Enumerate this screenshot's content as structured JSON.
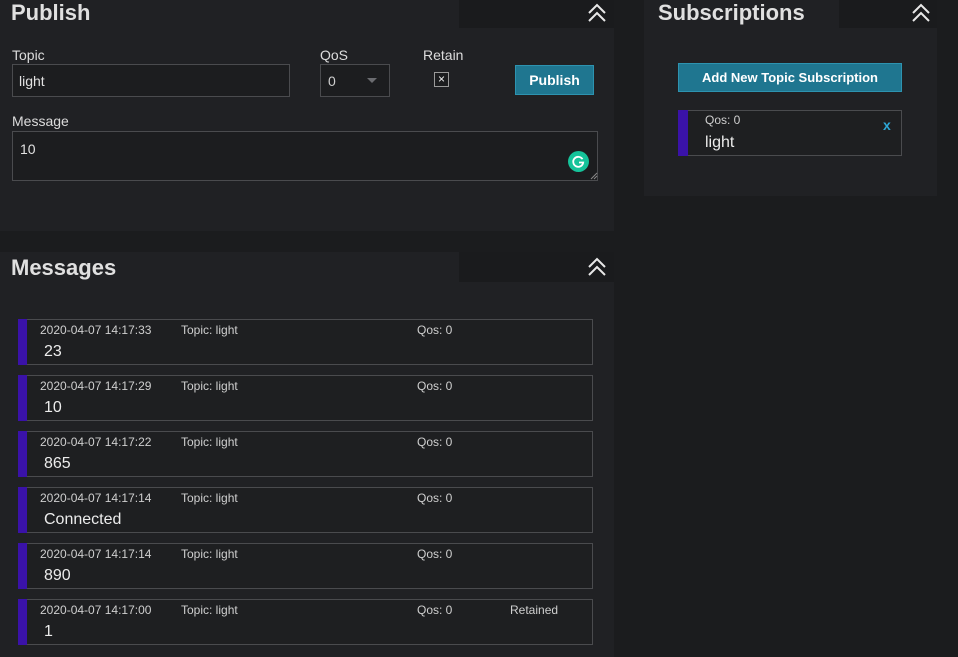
{
  "publish": {
    "title": "Publish",
    "topic_label": "Topic",
    "topic_value": "light",
    "qos_label": "QoS",
    "qos_value": "0",
    "retain_label": "Retain",
    "retain_mark": "×",
    "publish_button": "Publish",
    "message_label": "Message",
    "message_value": "10"
  },
  "subscriptions": {
    "title": "Subscriptions",
    "add_button": "Add New Topic Subscription",
    "items": [
      {
        "qos": "Qos: 0",
        "topic": "light",
        "remove": "x"
      }
    ]
  },
  "messages": {
    "title": "Messages",
    "items": [
      {
        "timestamp": "2020-04-07 14:17:33",
        "topic": "Topic: light",
        "qos": "Qos: 0",
        "retained": "",
        "payload": "23"
      },
      {
        "timestamp": "2020-04-07 14:17:29",
        "topic": "Topic: light",
        "qos": "Qos: 0",
        "retained": "",
        "payload": "10"
      },
      {
        "timestamp": "2020-04-07 14:17:22",
        "topic": "Topic: light",
        "qos": "Qos: 0",
        "retained": "",
        "payload": "865"
      },
      {
        "timestamp": "2020-04-07 14:17:14",
        "topic": "Topic: light",
        "qos": "Qos: 0",
        "retained": "",
        "payload": "Connected"
      },
      {
        "timestamp": "2020-04-07 14:17:14",
        "topic": "Topic: light",
        "qos": "Qos: 0",
        "retained": "",
        "payload": "890"
      },
      {
        "timestamp": "2020-04-07 14:17:00",
        "topic": "Topic: light",
        "qos": "Qos: 0",
        "retained": "Retained",
        "payload": "1"
      }
    ]
  },
  "colors": {
    "accent": "#1f7690",
    "message_bar": "#3a12a8",
    "grammarly": "#15c39a"
  },
  "icons": {
    "collapse": "double-chevron-up-icon",
    "dropdown": "caret-down-icon",
    "grammarly": "grammarly-icon"
  }
}
